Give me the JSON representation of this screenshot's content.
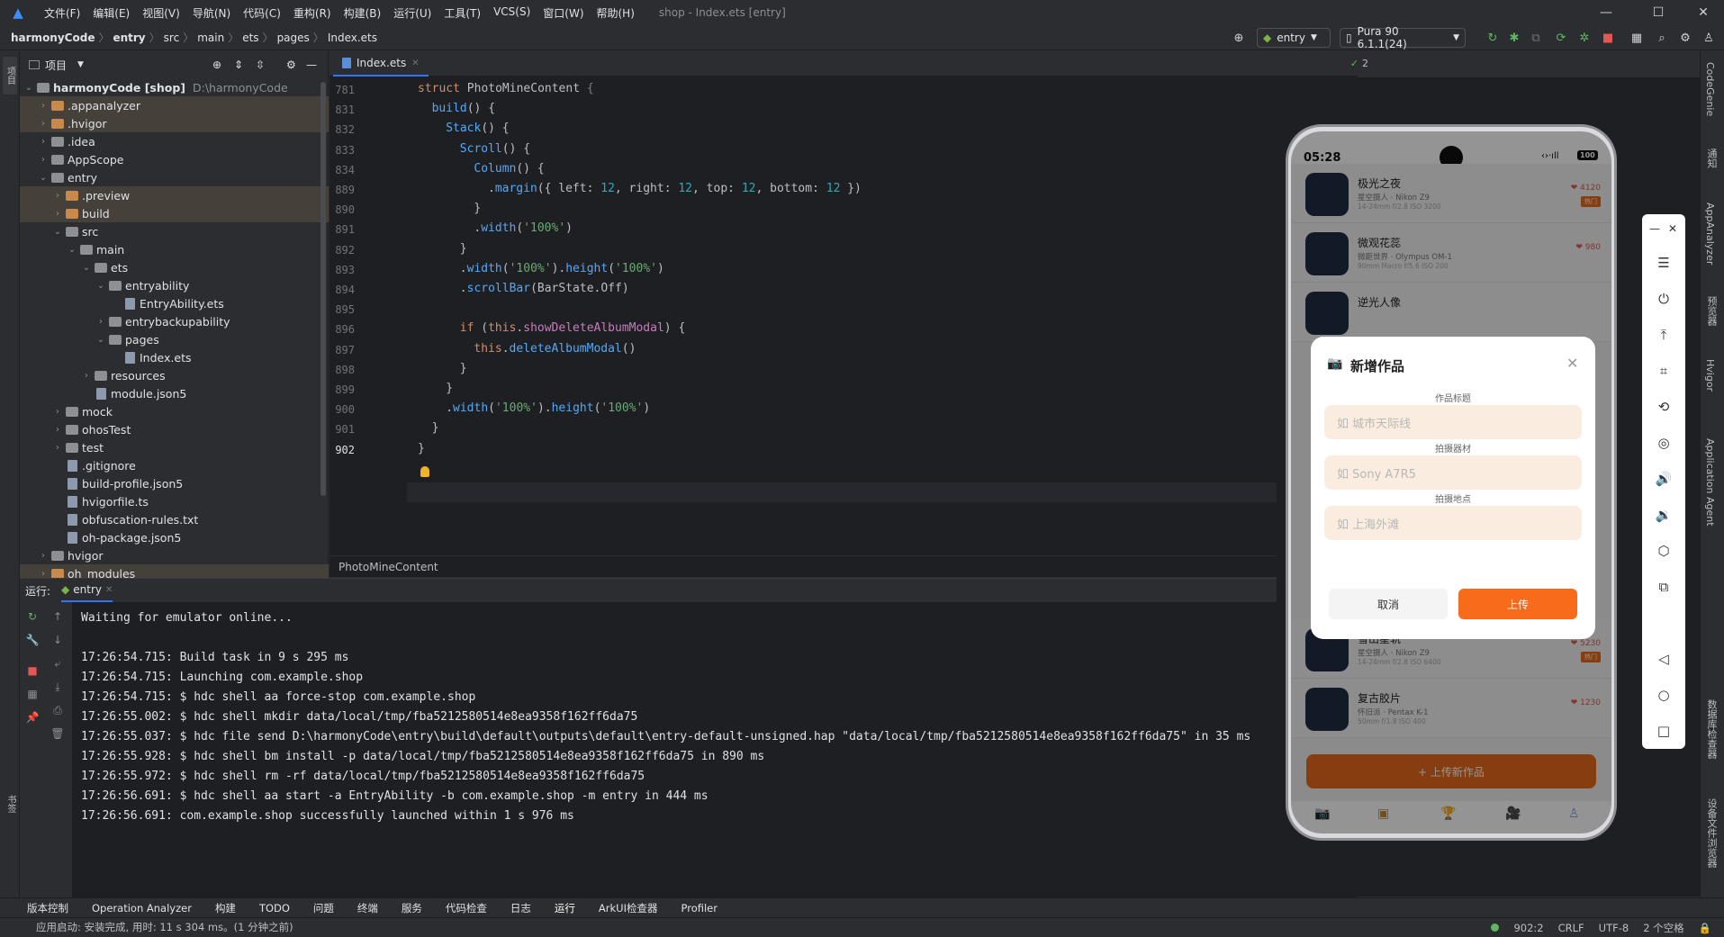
{
  "menubar": {
    "items": [
      "文件(F)",
      "编辑(E)",
      "视图(V)",
      "导航(N)",
      "代码(C)",
      "重构(R)",
      "构建(B)",
      "运行(U)",
      "工具(T)",
      "VCS(S)",
      "窗口(W)",
      "帮助(H)"
    ],
    "title": "shop - Index.ets [entry]"
  },
  "navbar": {
    "breadcrumbs": [
      "harmonyCode",
      "entry",
      "src",
      "main",
      "ets",
      "pages",
      "Index.ets"
    ],
    "run_config": "entry",
    "device": "Pura 90 6.1.1(24)"
  },
  "project_panel": {
    "title": "项目",
    "tree": [
      {
        "name": "harmonyCode [shop]",
        "extra": "D:\\harmonyCode",
        "depth": 0,
        "type": "folder",
        "open": true,
        "hl": false
      },
      {
        "name": ".appanalyzer",
        "depth": 1,
        "type": "folder",
        "color": "orange",
        "hl": true
      },
      {
        "name": ".hvigor",
        "depth": 1,
        "type": "folder",
        "color": "orange",
        "hl": true
      },
      {
        "name": ".idea",
        "depth": 1,
        "type": "folder"
      },
      {
        "name": "AppScope",
        "depth": 1,
        "type": "folder"
      },
      {
        "name": "entry",
        "depth": 1,
        "type": "folder",
        "open": true
      },
      {
        "name": ".preview",
        "depth": 2,
        "type": "folder",
        "color": "orange",
        "hl": true
      },
      {
        "name": "build",
        "depth": 2,
        "type": "folder",
        "color": "orange",
        "hl": true
      },
      {
        "name": "src",
        "depth": 2,
        "type": "folder",
        "open": true
      },
      {
        "name": "main",
        "depth": 3,
        "type": "folder",
        "open": true
      },
      {
        "name": "ets",
        "depth": 4,
        "type": "folder",
        "open": true
      },
      {
        "name": "entryability",
        "depth": 5,
        "type": "folder",
        "open": true
      },
      {
        "name": "EntryAbility.ets",
        "depth": 6,
        "type": "file"
      },
      {
        "name": "entrybackupability",
        "depth": 5,
        "type": "folder"
      },
      {
        "name": "pages",
        "depth": 5,
        "type": "folder",
        "open": true
      },
      {
        "name": "Index.ets",
        "depth": 6,
        "type": "file"
      },
      {
        "name": "resources",
        "depth": 4,
        "type": "folder"
      },
      {
        "name": "module.json5",
        "depth": 4,
        "type": "file"
      },
      {
        "name": "mock",
        "depth": 2,
        "type": "folder"
      },
      {
        "name": "ohosTest",
        "depth": 2,
        "type": "folder"
      },
      {
        "name": "test",
        "depth": 2,
        "type": "folder"
      },
      {
        "name": ".gitignore",
        "depth": 2,
        "type": "file"
      },
      {
        "name": "build-profile.json5",
        "depth": 2,
        "type": "file"
      },
      {
        "name": "hvigorfile.ts",
        "depth": 2,
        "type": "file"
      },
      {
        "name": "obfuscation-rules.txt",
        "depth": 2,
        "type": "file"
      },
      {
        "name": "oh-package.json5",
        "depth": 2,
        "type": "file"
      },
      {
        "name": "hvigor",
        "depth": 1,
        "type": "folder"
      },
      {
        "name": "oh_modules",
        "depth": 1,
        "type": "folder",
        "color": "orange",
        "hl": true
      }
    ]
  },
  "editor": {
    "tab": "Index.ets",
    "problems_count": "2",
    "lines": [
      {
        "n": "781",
        "indent": 0,
        "tokens": [
          [
            "kw",
            "struct "
          ],
          [
            "ty",
            "PhotoMineContent "
          ],
          [
            "cl",
            "{"
          ]
        ]
      },
      {
        "n": "831",
        "indent": 1,
        "tokens": [
          [
            "fn",
            "build"
          ],
          [
            "ty",
            "() {"
          ]
        ]
      },
      {
        "n": "832",
        "indent": 2,
        "tokens": [
          [
            "fn",
            "Stack"
          ],
          [
            "ty",
            "() {"
          ]
        ]
      },
      {
        "n": "833",
        "indent": 3,
        "tokens": [
          [
            "fn",
            "Scroll"
          ],
          [
            "ty",
            "() {"
          ]
        ]
      },
      {
        "n": "834",
        "indent": 4,
        "tokens": [
          [
            "fn",
            "Column"
          ],
          [
            "ty",
            "() {"
          ]
        ]
      },
      {
        "n": "889",
        "indent": 5,
        "tokens": [
          [
            "ty",
            "."
          ],
          [
            "fn",
            "margin"
          ],
          [
            "ty",
            "({ left: "
          ],
          [
            "nm",
            "12"
          ],
          [
            "ty",
            ", right: "
          ],
          [
            "nm",
            "12"
          ],
          [
            "ty",
            ", top: "
          ],
          [
            "nm",
            "12"
          ],
          [
            "ty",
            ", bottom: "
          ],
          [
            "nm",
            "12"
          ],
          [
            "ty",
            " })"
          ]
        ]
      },
      {
        "n": "890",
        "indent": 4,
        "tokens": [
          [
            "ty",
            "}"
          ]
        ]
      },
      {
        "n": "891",
        "indent": 4,
        "tokens": [
          [
            "ty",
            "."
          ],
          [
            "fn",
            "width"
          ],
          [
            "ty",
            "("
          ],
          [
            "st",
            "'100%'"
          ],
          [
            "ty",
            ")"
          ]
        ]
      },
      {
        "n": "892",
        "indent": 3,
        "tokens": [
          [
            "ty",
            "}"
          ]
        ]
      },
      {
        "n": "893",
        "indent": 3,
        "tokens": [
          [
            "ty",
            "."
          ],
          [
            "fn",
            "width"
          ],
          [
            "ty",
            "("
          ],
          [
            "st",
            "'100%'"
          ],
          [
            "ty",
            ")."
          ],
          [
            "fn",
            "height"
          ],
          [
            "ty",
            "("
          ],
          [
            "st",
            "'100%'"
          ],
          [
            "ty",
            ")"
          ]
        ]
      },
      {
        "n": "894",
        "indent": 3,
        "tokens": [
          [
            "ty",
            "."
          ],
          [
            "fn",
            "scrollBar"
          ],
          [
            "ty",
            "(BarState.Off)"
          ]
        ]
      },
      {
        "n": "895",
        "indent": 0,
        "tokens": []
      },
      {
        "n": "896",
        "indent": 3,
        "tokens": [
          [
            "kw",
            "if "
          ],
          [
            "ty",
            "("
          ],
          [
            "kw",
            "this"
          ],
          [
            "ty",
            "."
          ],
          [
            "pr",
            "showDeleteAlbumModal"
          ],
          [
            "ty",
            ") {"
          ]
        ]
      },
      {
        "n": "897",
        "indent": 4,
        "tokens": [
          [
            "kw",
            "this"
          ],
          [
            "ty",
            "."
          ],
          [
            "fn",
            "deleteAlbumModal"
          ],
          [
            "ty",
            "()"
          ]
        ]
      },
      {
        "n": "898",
        "indent": 3,
        "tokens": [
          [
            "ty",
            "}"
          ]
        ]
      },
      {
        "n": "899",
        "indent": 2,
        "tokens": [
          [
            "ty",
            "}"
          ]
        ]
      },
      {
        "n": "900",
        "indent": 2,
        "tokens": [
          [
            "ty",
            "."
          ],
          [
            "fn",
            "width"
          ],
          [
            "ty",
            "("
          ],
          [
            "st",
            "'100%'"
          ],
          [
            "ty",
            ")."
          ],
          [
            "fn",
            "height"
          ],
          [
            "ty",
            "("
          ],
          [
            "st",
            "'100%'"
          ],
          [
            "ty",
            ")"
          ]
        ]
      },
      {
        "n": "901",
        "indent": 1,
        "tokens": [
          [
            "ty",
            "}"
          ]
        ]
      },
      {
        "n": "902",
        "indent": 0,
        "tokens": [
          [
            "ty",
            "}"
          ]
        ]
      }
    ],
    "crumb": "PhotoMineContent"
  },
  "run_panel": {
    "label": "运行:",
    "tab": "entry",
    "log": [
      "Waiting for emulator online...",
      "",
      "17:26:54.715: Build task in 9 s 295 ms",
      "17:26:54.715: Launching com.example.shop",
      "17:26:54.715: $ hdc shell aa force-stop com.example.shop",
      "17:26:55.002: $ hdc shell mkdir data/local/tmp/fba5212580514e8ea9358f162ff6da75",
      "17:26:55.037: $ hdc file send D:\\harmonyCode\\entry\\build\\default\\outputs\\default\\entry-default-unsigned.hap \"data/local/tmp/fba5212580514e8ea9358f162ff6da75\" in 35 ms",
      "17:26:55.928: $ hdc shell bm install -p data/local/tmp/fba5212580514e8ea9358f162ff6da75 in 890 ms",
      "17:26:55.972: $ hdc shell rm -rf data/local/tmp/fba5212580514e8ea9358f162ff6da75",
      "17:26:56.691: $ hdc shell aa start -a EntryAbility -b com.example.shop -m entry in 444 ms",
      "17:26:56.691: com.example.shop successfully launched within 1 s 976 ms"
    ]
  },
  "right_strip": [
    "CodeGenie",
    "通知",
    "AppAnalyzer",
    "预览器",
    "Hvigor",
    "Application Agent",
    "数据库检查器",
    "设备文件浏览器"
  ],
  "left_strip_bottom": "书签",
  "left_strip_top": "项目",
  "phone": {
    "time": "05:28",
    "battery": "100",
    "list": [
      {
        "title": "极光之夜",
        "sub": "星空摄人 · Nikon Z9",
        "sub2": "14-24mm f/2.8 ISO 3200",
        "likes": "4120",
        "hot": "热门"
      },
      {
        "title": "微观花蕊",
        "sub": "微距世界 · Olympus OM-1",
        "sub2": "90mm Macro f/5.6 ISO 200",
        "likes": "980",
        "hot": ""
      },
      {
        "title": "逆光人像",
        "sub": "",
        "sub2": "",
        "likes": "",
        "hot": ""
      }
    ],
    "list_bottom": [
      {
        "title": "雪山星轨",
        "sub": "星空摄人 · Nikon Z9",
        "sub2": "14-24mm f/2.8 ISO 6400",
        "likes": "5230",
        "hot": "热门"
      },
      {
        "title": "复古胶片",
        "sub": "怀旧派 · Pentax K-1",
        "sub2": "50mm f/1.8 ISO 400",
        "likes": "1230",
        "hot": ""
      }
    ],
    "upload_button": "+ 上传新作品",
    "modal": {
      "title": "新增作品",
      "fields": [
        {
          "label": "作品标题",
          "placeholder": "如 城市天际线"
        },
        {
          "label": "拍摄器材",
          "placeholder": "如 Sony A7R5"
        },
        {
          "label": "拍摄地点",
          "placeholder": "如 上海外滩"
        }
      ],
      "cancel": "取消",
      "confirm": "上传"
    }
  },
  "bottom_tools": [
    "版本控制",
    "Operation Analyzer",
    "构建",
    "TODO",
    "问题",
    "终端",
    "服务",
    "代码检查",
    "日志",
    "运行",
    "ArkUI检查器",
    "Profiler"
  ],
  "status": {
    "message": "应用启动: 安装完成, 用时: 11 s 304 ms。(1 分钟之前)",
    "position": "902:2",
    "line_sep": "CRLF",
    "encoding": "UTF-8",
    "indent": "2 个空格"
  }
}
